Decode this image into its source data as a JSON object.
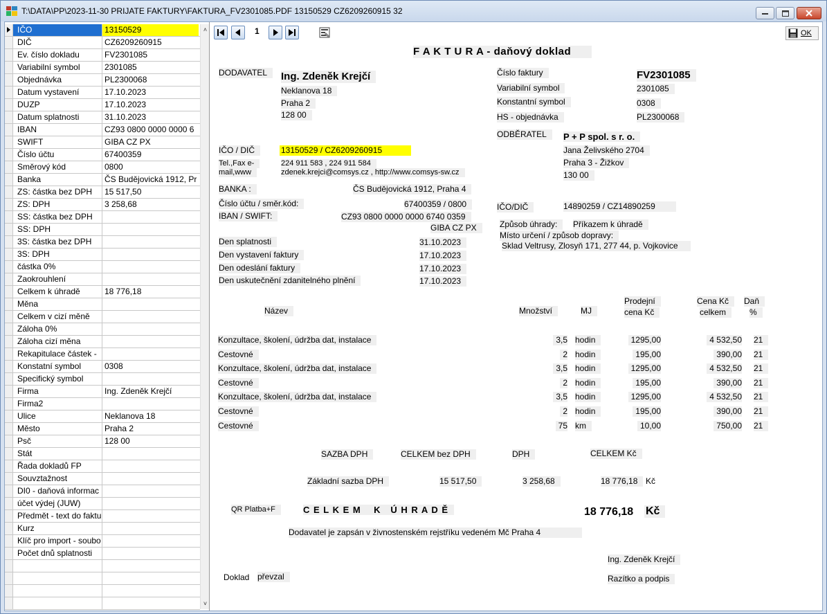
{
  "window": {
    "title": "T:\\DATA\\PP\\2023-11-30 PRIJATE FAKTURY\\FAKTURA_FV2301085.PDF 13150529 CZ6209260915 32",
    "ok_label": "OK"
  },
  "pager": {
    "page": "1"
  },
  "grid": {
    "rows": [
      {
        "name": "IČO",
        "value": "13150529"
      },
      {
        "name": "DIČ",
        "value": "CZ6209260915"
      },
      {
        "name": "Ev. číslo dokladu",
        "value": "FV2301085"
      },
      {
        "name": "Variabilní symbol",
        "value": "2301085"
      },
      {
        "name": "Objednávka",
        "value": "PL2300068"
      },
      {
        "name": "Datum vystavení",
        "value": "17.10.2023"
      },
      {
        "name": "DUZP",
        "value": "17.10.2023"
      },
      {
        "name": "Datum splatnosti",
        "value": "31.10.2023"
      },
      {
        "name": "IBAN",
        "value": "CZ93 0800 0000 0000 6"
      },
      {
        "name": "SWIFT",
        "value": "GIBA CZ PX"
      },
      {
        "name": "Číslo účtu",
        "value": "67400359"
      },
      {
        "name": "Směrový kód",
        "value": "0800"
      },
      {
        "name": "Banka",
        "value": "ČS Budějovická 1912, Pr"
      },
      {
        "name": "ZS: částka bez DPH",
        "value": "15 517,50"
      },
      {
        "name": "ZS: DPH",
        "value": "3 258,68"
      },
      {
        "name": "SS: částka bez DPH",
        "value": ""
      },
      {
        "name": "SS: DPH",
        "value": ""
      },
      {
        "name": "3S: částka bez DPH",
        "value": ""
      },
      {
        "name": "3S: DPH",
        "value": ""
      },
      {
        "name": "částka 0%",
        "value": ""
      },
      {
        "name": "Zaokrouhlení",
        "value": ""
      },
      {
        "name": "Celkem k úhradě",
        "value": "18 776,18"
      },
      {
        "name": "Měna",
        "value": ""
      },
      {
        "name": "Celkem v cizí měně",
        "value": ""
      },
      {
        "name": "Záloha 0%",
        "value": ""
      },
      {
        "name": "Záloha cizí měna",
        "value": ""
      },
      {
        "name": "Rekapitulace částek -",
        "value": ""
      },
      {
        "name": "Konstatní symbol",
        "value": "0308"
      },
      {
        "name": "Specifický symbol",
        "value": ""
      },
      {
        "name": "Firma",
        "value": "Ing. Zdeněk Krejčí"
      },
      {
        "name": "Firma2",
        "value": ""
      },
      {
        "name": "Ulice",
        "value": "Neklanova 18"
      },
      {
        "name": "Město",
        "value": "Praha 2"
      },
      {
        "name": "Psč",
        "value": "128 00"
      },
      {
        "name": "Stát",
        "value": ""
      },
      {
        "name": "Řada dokladů FP",
        "value": ""
      },
      {
        "name": "Souvztažnost",
        "value": ""
      },
      {
        "name": "DI0 - daňová informac",
        "value": ""
      },
      {
        "name": "účet výdej (JUW)",
        "value": ""
      },
      {
        "name": "Předmět - text do faktu",
        "value": ""
      },
      {
        "name": "Kurz",
        "value": ""
      },
      {
        "name": "Klíč pro import - soubo",
        "value": ""
      },
      {
        "name": "Počet dnů splatnosti",
        "value": ""
      },
      {
        "name": "",
        "value": ""
      },
      {
        "name": "",
        "value": ""
      },
      {
        "name": "",
        "value": ""
      },
      {
        "name": "",
        "value": ""
      }
    ]
  },
  "invoice": {
    "title": "F A K T U R A - daňový doklad",
    "supplier": {
      "label": "DODAVATEL",
      "name": "Ing. Zdeněk Krejčí",
      "street": "Neklanova 18",
      "city": "Praha 2",
      "zip": "128 00",
      "ico_label": "IČO / DIČ",
      "ico_value": "13150529 / CZ6209260915",
      "tel_label_1": "Tel.,Fax e-",
      "tel_label_2": "mail,www",
      "tel_value": "224 911 583 , 224 911 584",
      "email_value": "zdenek.krejci@comsys.cz , http://www.comsys-sw.cz"
    },
    "bank": {
      "label": "BANKA :",
      "value": "ČS Budějovická 1912, Praha 4",
      "account_label": "Číslo účtu / směr.kód:",
      "account_value": "67400359 / 0800",
      "iban_label": "IBAN / SWIFT:",
      "iban_value": "CZ93 0800 0000 0000 6740 0359",
      "swift_value": "GIBA CZ PX"
    },
    "dates": [
      {
        "label": "Den splatnosti",
        "value": "31.10.2023"
      },
      {
        "label": "Den vystavení faktury",
        "value": "17.10.2023"
      },
      {
        "label": "Den odeslání faktury",
        "value": "17.10.2023"
      },
      {
        "label": "Den uskutečnění zdanitelného plnění",
        "value": "17.10.2023"
      }
    ],
    "header_right": {
      "invoice_no_label": "Číslo faktury",
      "invoice_no": "FV2301085",
      "vs_label": "Variabilní symbol",
      "vs": "2301085",
      "ks_label": "Konstantní symbol",
      "ks": "0308",
      "order_label": "HS - objednávka",
      "order": "PL2300068"
    },
    "customer": {
      "label": "ODBĚRATEL",
      "name": "P + P spol. s r. o.",
      "street": "Jana Želivského 2704",
      "city": "Praha 3 - Žižkov",
      "zip": "130 00",
      "ico_label": "IČO/DIČ",
      "ico_value": "14890259 / CZ14890259",
      "payment_label": "Způsob úhrady:",
      "payment_value": "Příkazem k úhradě",
      "delivery_label": "Místo určení / způsob dopravy:",
      "delivery_value": "Sklad Veltrusy, Zlosyň 171, 277 44, p. Vojkovice"
    },
    "items_header": {
      "name": "Název",
      "qty": "Množství",
      "unit": "MJ",
      "price_1": "Prodejní",
      "price_2": "cena Kč",
      "total_1": "Cena Kč",
      "total_2": "celkem",
      "vat_1": "Daň",
      "vat_2": "%"
    },
    "items": [
      {
        "name": "Konzultace, školení, údržba dat, instalace",
        "qty": "3,5",
        "unit": "hodin",
        "price": "1295,00",
        "total": "4 532,50",
        "vat": "21"
      },
      {
        "name": "Cestovné",
        "qty": "2",
        "unit": "hodin",
        "price": "195,00",
        "total": "390,00",
        "vat": "21"
      },
      {
        "name": "Konzultace, školení, údržba dat, instalace",
        "qty": "3,5",
        "unit": "hodin",
        "price": "1295,00",
        "total": "4 532,50",
        "vat": "21"
      },
      {
        "name": "Cestovné",
        "qty": "2",
        "unit": "hodin",
        "price": "195,00",
        "total": "390,00",
        "vat": "21"
      },
      {
        "name": "Konzultace, školení, údržba dat, instalace",
        "qty": "3,5",
        "unit": "hodin",
        "price": "1295,00",
        "total": "4 532,50",
        "vat": "21"
      },
      {
        "name": "Cestovné",
        "qty": "2",
        "unit": "hodin",
        "price": "195,00",
        "total": "390,00",
        "vat": "21"
      },
      {
        "name": "Cestovné",
        "qty": "75",
        "unit": "km",
        "price": "10,00",
        "total": "750,00",
        "vat": "21"
      }
    ],
    "vat_summary": {
      "rate_label": "SAZBA DPH",
      "base_label": "CELKEM bez DPH",
      "vat_label": "DPH",
      "total_label": "CELKEM Kč",
      "row_label": "Základní sazba DPH",
      "base": "15 517,50",
      "vat": "3 258,68",
      "total": "18 776,18",
      "currency": "Kč"
    },
    "qr_label": "QR Platba+F",
    "grand_total_label": "C E L K E M    K   Ú H R A D Ě",
    "grand_total": "18 776,18",
    "grand_currency": "Kč",
    "register_note": "Dodavatel je zapsán v živnostenském rejstříku vedeném Mč Praha 4",
    "signer": "Ing. Zdeněk Krejčí",
    "received_label": "Doklad",
    "received_value": "převzal",
    "stamp_label": "Razítko a podpis"
  },
  "colors": {
    "selected_row": "#1f6fd0",
    "highlight": "#ffff00",
    "field_bg": "#efefef"
  }
}
